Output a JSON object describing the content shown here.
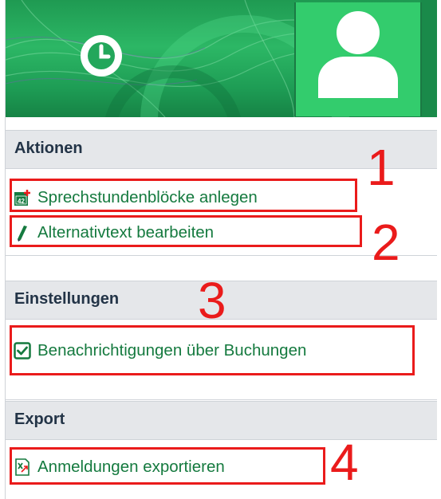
{
  "sections": [
    {
      "title": "Aktionen",
      "items": [
        {
          "label": "Sprechstundenblöcke anlegen",
          "icon": "calendar-add-icon"
        },
        {
          "label": "Alternativtext bearbeiten",
          "icon": "pencil-icon"
        }
      ]
    },
    {
      "title": "Einstellungen",
      "items": [
        {
          "label": "Benachrichtigungen über Buchungen",
          "icon": "checkbox-checked-icon"
        }
      ]
    },
    {
      "title": "Export",
      "items": [
        {
          "label": "Anmeldungen exportieren",
          "icon": "excel-export-icon"
        }
      ]
    }
  ],
  "calendar_icon_number": "42",
  "annotations": [
    "1",
    "2",
    "3",
    "4"
  ],
  "colors": {
    "brand_green": "#157a3f",
    "banner_green": "#2cb765",
    "annotation_red": "#ea1b1b",
    "header_bg": "#e5e7ea"
  }
}
